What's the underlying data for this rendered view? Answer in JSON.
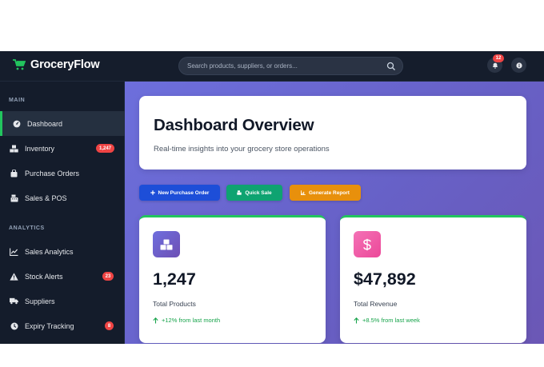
{
  "app": {
    "name": "GroceryFlow"
  },
  "topbar": {
    "search_placeholder": "Search products, suppliers, or orders...",
    "notifications_count": "12"
  },
  "sidebar": {
    "sections": [
      {
        "title": "MAIN",
        "items": [
          {
            "label": "Dashboard",
            "icon": "gauge-icon",
            "active": true
          },
          {
            "label": "Inventory",
            "icon": "boxes-icon",
            "badge": "1,247"
          },
          {
            "label": "Purchase Orders",
            "icon": "shopping-bag-icon"
          },
          {
            "label": "Sales & POS",
            "icon": "cash-register-icon"
          }
        ]
      },
      {
        "title": "ANALYTICS",
        "items": [
          {
            "label": "Sales Analytics",
            "icon": "line-chart-icon"
          },
          {
            "label": "Stock Alerts",
            "icon": "warning-icon",
            "badge": "23"
          },
          {
            "label": "Suppliers",
            "icon": "truck-icon"
          },
          {
            "label": "Expiry Tracking",
            "icon": "clock-icon",
            "badge": "8"
          }
        ]
      }
    ]
  },
  "hero": {
    "title": "Dashboard Overview",
    "subtitle": "Real-time insights into your grocery store operations"
  },
  "actions": {
    "new_po": "New Purchase Order",
    "quick_sale": "Quick Sale",
    "generate_report": "Generate Report"
  },
  "stats": [
    {
      "value": "1,247",
      "label": "Total Products",
      "trend": "+12% from last month",
      "icon": "boxes-icon"
    },
    {
      "value": "$47,892",
      "label": "Total Revenue",
      "trend": "+8.5% from last week",
      "icon": "dollar-icon"
    }
  ],
  "colors": {
    "accent_green": "#22c55e",
    "badge_red": "#ef4444",
    "primary_blue": "#1d4ed8",
    "success_green": "#0ea371",
    "warning_orange": "#e8900c"
  }
}
